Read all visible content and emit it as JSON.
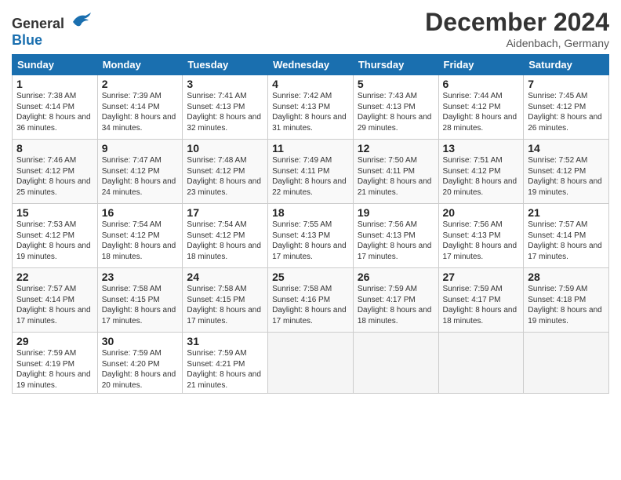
{
  "header": {
    "logo_general": "General",
    "logo_blue": "Blue",
    "month_year": "December 2024",
    "location": "Aidenbach, Germany"
  },
  "weekdays": [
    "Sunday",
    "Monday",
    "Tuesday",
    "Wednesday",
    "Thursday",
    "Friday",
    "Saturday"
  ],
  "weeks": [
    [
      {
        "day": "1",
        "sunrise": "7:38 AM",
        "sunset": "4:14 PM",
        "daylight": "8 hours and 36 minutes."
      },
      {
        "day": "2",
        "sunrise": "7:39 AM",
        "sunset": "4:14 PM",
        "daylight": "8 hours and 34 minutes."
      },
      {
        "day": "3",
        "sunrise": "7:41 AM",
        "sunset": "4:13 PM",
        "daylight": "8 hours and 32 minutes."
      },
      {
        "day": "4",
        "sunrise": "7:42 AM",
        "sunset": "4:13 PM",
        "daylight": "8 hours and 31 minutes."
      },
      {
        "day": "5",
        "sunrise": "7:43 AM",
        "sunset": "4:13 PM",
        "daylight": "8 hours and 29 minutes."
      },
      {
        "day": "6",
        "sunrise": "7:44 AM",
        "sunset": "4:12 PM",
        "daylight": "8 hours and 28 minutes."
      },
      {
        "day": "7",
        "sunrise": "7:45 AM",
        "sunset": "4:12 PM",
        "daylight": "8 hours and 26 minutes."
      }
    ],
    [
      {
        "day": "8",
        "sunrise": "7:46 AM",
        "sunset": "4:12 PM",
        "daylight": "8 hours and 25 minutes."
      },
      {
        "day": "9",
        "sunrise": "7:47 AM",
        "sunset": "4:12 PM",
        "daylight": "8 hours and 24 minutes."
      },
      {
        "day": "10",
        "sunrise": "7:48 AM",
        "sunset": "4:12 PM",
        "daylight": "8 hours and 23 minutes."
      },
      {
        "day": "11",
        "sunrise": "7:49 AM",
        "sunset": "4:11 PM",
        "daylight": "8 hours and 22 minutes."
      },
      {
        "day": "12",
        "sunrise": "7:50 AM",
        "sunset": "4:11 PM",
        "daylight": "8 hours and 21 minutes."
      },
      {
        "day": "13",
        "sunrise": "7:51 AM",
        "sunset": "4:12 PM",
        "daylight": "8 hours and 20 minutes."
      },
      {
        "day": "14",
        "sunrise": "7:52 AM",
        "sunset": "4:12 PM",
        "daylight": "8 hours and 19 minutes."
      }
    ],
    [
      {
        "day": "15",
        "sunrise": "7:53 AM",
        "sunset": "4:12 PM",
        "daylight": "8 hours and 19 minutes."
      },
      {
        "day": "16",
        "sunrise": "7:54 AM",
        "sunset": "4:12 PM",
        "daylight": "8 hours and 18 minutes."
      },
      {
        "day": "17",
        "sunrise": "7:54 AM",
        "sunset": "4:12 PM",
        "daylight": "8 hours and 18 minutes."
      },
      {
        "day": "18",
        "sunrise": "7:55 AM",
        "sunset": "4:13 PM",
        "daylight": "8 hours and 17 minutes."
      },
      {
        "day": "19",
        "sunrise": "7:56 AM",
        "sunset": "4:13 PM",
        "daylight": "8 hours and 17 minutes."
      },
      {
        "day": "20",
        "sunrise": "7:56 AM",
        "sunset": "4:13 PM",
        "daylight": "8 hours and 17 minutes."
      },
      {
        "day": "21",
        "sunrise": "7:57 AM",
        "sunset": "4:14 PM",
        "daylight": "8 hours and 17 minutes."
      }
    ],
    [
      {
        "day": "22",
        "sunrise": "7:57 AM",
        "sunset": "4:14 PM",
        "daylight": "8 hours and 17 minutes."
      },
      {
        "day": "23",
        "sunrise": "7:58 AM",
        "sunset": "4:15 PM",
        "daylight": "8 hours and 17 minutes."
      },
      {
        "day": "24",
        "sunrise": "7:58 AM",
        "sunset": "4:15 PM",
        "daylight": "8 hours and 17 minutes."
      },
      {
        "day": "25",
        "sunrise": "7:58 AM",
        "sunset": "4:16 PM",
        "daylight": "8 hours and 17 minutes."
      },
      {
        "day": "26",
        "sunrise": "7:59 AM",
        "sunset": "4:17 PM",
        "daylight": "8 hours and 18 minutes."
      },
      {
        "day": "27",
        "sunrise": "7:59 AM",
        "sunset": "4:17 PM",
        "daylight": "8 hours and 18 minutes."
      },
      {
        "day": "28",
        "sunrise": "7:59 AM",
        "sunset": "4:18 PM",
        "daylight": "8 hours and 19 minutes."
      }
    ],
    [
      {
        "day": "29",
        "sunrise": "7:59 AM",
        "sunset": "4:19 PM",
        "daylight": "8 hours and 19 minutes."
      },
      {
        "day": "30",
        "sunrise": "7:59 AM",
        "sunset": "4:20 PM",
        "daylight": "8 hours and 20 minutes."
      },
      {
        "day": "31",
        "sunrise": "7:59 AM",
        "sunset": "4:21 PM",
        "daylight": "8 hours and 21 minutes."
      },
      null,
      null,
      null,
      null
    ]
  ]
}
